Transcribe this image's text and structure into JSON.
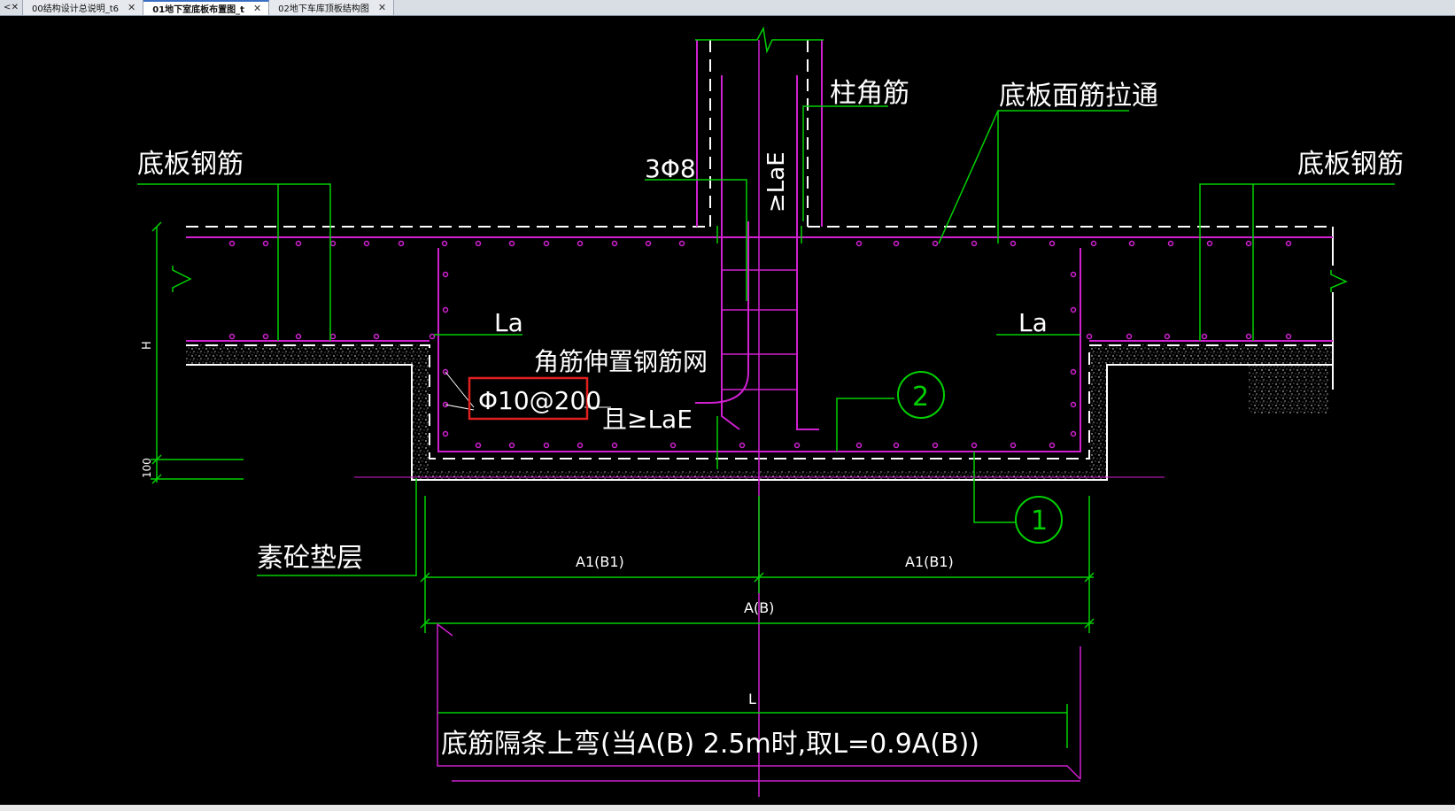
{
  "tabs": {
    "stub_glyph": "<",
    "items": [
      {
        "label": "00结构设计总说明_t6"
      },
      {
        "label": "01地下室底板布置图_t"
      },
      {
        "label": "02地下车库顶板结构图"
      }
    ]
  },
  "drawing": {
    "label_slab_rebar_left": "底板钢筋",
    "label_slab_rebar_right": "底板钢筋",
    "label_column_corner_rebar": "柱角筋",
    "label_top_rebar_through": "底板面筋拉通",
    "label_3phi8": "3Φ8",
    "label_laE_vertical": "≥LaE",
    "label_la_left": "La",
    "label_la_right": "La",
    "label_corner_mesh": "角筋伸置钢筋网",
    "label_phi10": "Φ10@200",
    "label_and_laE": "且≥LaE",
    "label_h": "H",
    "label_100": "100",
    "label_plain_concrete": "素砼垫层",
    "circle_1": "1",
    "circle_2": "2",
    "dim_a1_left": "A1(B1)",
    "dim_a1_right": "A1(B1)",
    "dim_ab": "A(B)",
    "dim_l": "L",
    "note_bottom": "底筋隔条上弯(当A(B) 2.5m时,取L=0.9A(B))"
  },
  "colors": {
    "background": "#000000",
    "rebar_magenta": "#d020d0",
    "leader_green": "#00d000",
    "text_white": "#ffffff",
    "highlight_red": "#e02020"
  }
}
